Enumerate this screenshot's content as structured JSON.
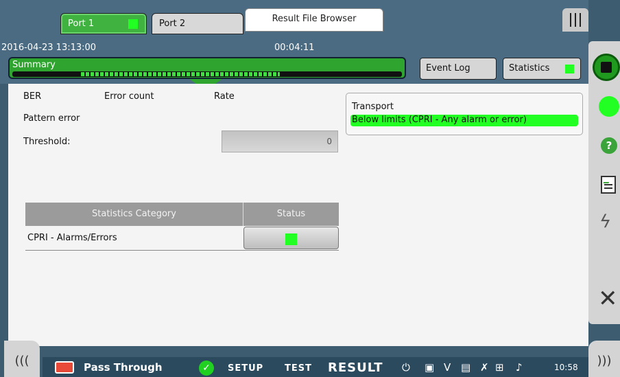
{
  "header": {
    "tabs": [
      {
        "label": "Port 1",
        "active": true
      },
      {
        "label": "Port 2",
        "active": false
      }
    ],
    "browser_tab": "Result File Browser",
    "datetime": "2016-04-23 13:13:00",
    "elapsed": "00:04:11",
    "summary_label": "Summary",
    "event_log_label": "Event Log",
    "statistics_label": "Statistics"
  },
  "main": {
    "col_ber": "BER",
    "col_error_count": "Error count",
    "col_rate": "Rate",
    "pattern_error_label": "Pattern error",
    "threshold_label": "Threshold:",
    "threshold_value": "0",
    "transport": {
      "title": "Transport",
      "status": "Below limits (CPRI - Any alarm or error)"
    },
    "table": {
      "headers": [
        "Statistics Category",
        "Status"
      ],
      "rows": [
        {
          "category": "CPRI - Alarms/Errors",
          "status": "ok"
        }
      ]
    }
  },
  "taskbar": {
    "app_name": "Pass Through",
    "nav_setup": "SETUP",
    "nav_test": "TEST",
    "nav_result": "RESULT",
    "clock": "10:58"
  },
  "colors": {
    "accent_green": "#22ff22",
    "tab_green": "#3fb23f",
    "header_bg": "#4a6b82",
    "taskbar_bg": "#2b4a5e"
  },
  "icons": [
    "menu-icon",
    "stop-icon",
    "status-led-icon",
    "help-icon",
    "report-icon",
    "lightning-icon",
    "close-icon",
    "app-icon",
    "check-icon",
    "power-icon",
    "storage-icon",
    "v-icon",
    "terminal-icon",
    "mute-icon",
    "network-icon",
    "volume-icon"
  ]
}
